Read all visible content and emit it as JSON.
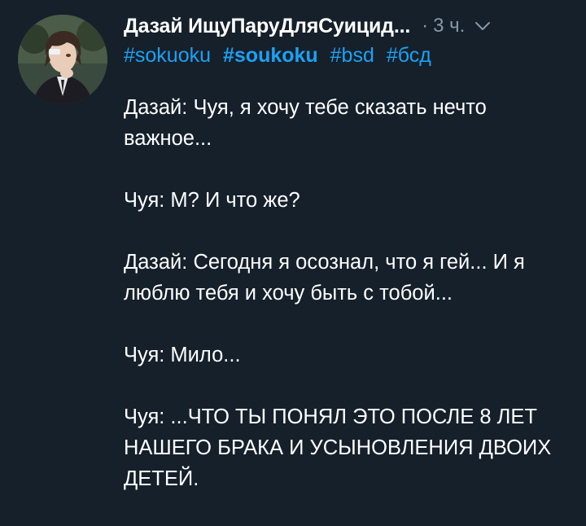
{
  "author": {
    "name": "Дазай ИщуПаруДляСуицид...",
    "time": "3 ч.",
    "separator": "·"
  },
  "hashtags": [
    {
      "text": "#sokuoku",
      "bold": false
    },
    {
      "text": "#soukoku",
      "bold": true
    },
    {
      "text": "#bsd",
      "bold": false
    },
    {
      "text": "#бсд",
      "bold": false
    }
  ],
  "body": [
    "Дазай: Чуя, я хочу тебе сказать нечто важное...",
    "Чуя: М? И что же?",
    "Дазай: Сегодня я осознал, что я гей... И я люблю тебя и хочу быть с тобой...",
    "Чуя: Мило...",
    "Чуя: ...ЧТО ТЫ ПОНЯЛ ЭТО ПОСЛЕ 8 ЛЕТ НАШЕГО БРАКА И УСЫНОВЛЕНИЯ ДВОИХ ДЕТЕЙ."
  ],
  "colors": {
    "background": "#15202b",
    "text": "#ffffff",
    "secondary": "#8899a6",
    "link": "#1da1f2"
  },
  "icons": {
    "menu": "chevron-down-icon"
  }
}
